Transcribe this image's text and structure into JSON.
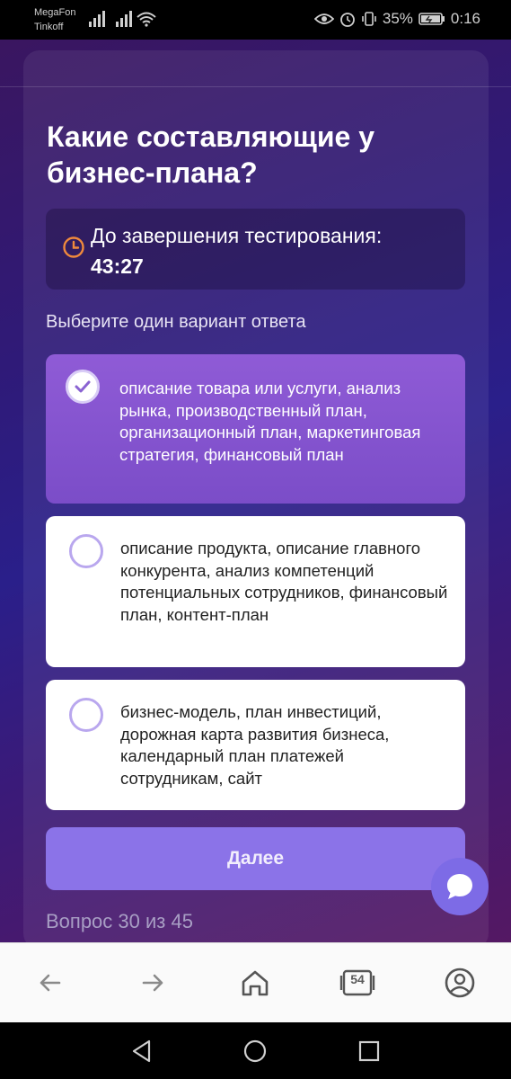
{
  "status_bar": {
    "carrier_1": "MegaFon",
    "carrier_2": "Tinkoff",
    "battery": "35%",
    "time": "0:16"
  },
  "quiz": {
    "question": "Какие составляющие у бизнес-плана?",
    "timer_label": "До завершения тестирования:",
    "timer_value": "43:27",
    "instruction": "Выберите один вариант ответа",
    "options": [
      {
        "text": "описание товара или услуги, анализ рынка, производственный план, организационный план, маркетинговая стратегия, финансовый план",
        "selected": true
      },
      {
        "text": "описание продукта, описание главного конкурента, анализ компетенций потенциальных сотрудников, финансовый план, контент-план",
        "selected": false
      },
      {
        "text": "бизнес-модель, план инвестиций, дорожная карта развития бизнеса, календарный план платежей сотрудникам, сайт",
        "selected": false
      }
    ],
    "next_label": "Далее",
    "progress": "Вопрос 30 из 45"
  },
  "browser_nav": {
    "tab_count": "54"
  },
  "colors": {
    "accent": "#8b73e8",
    "selected_option": "#8256cf",
    "timer_icon": "#f08a3c"
  }
}
